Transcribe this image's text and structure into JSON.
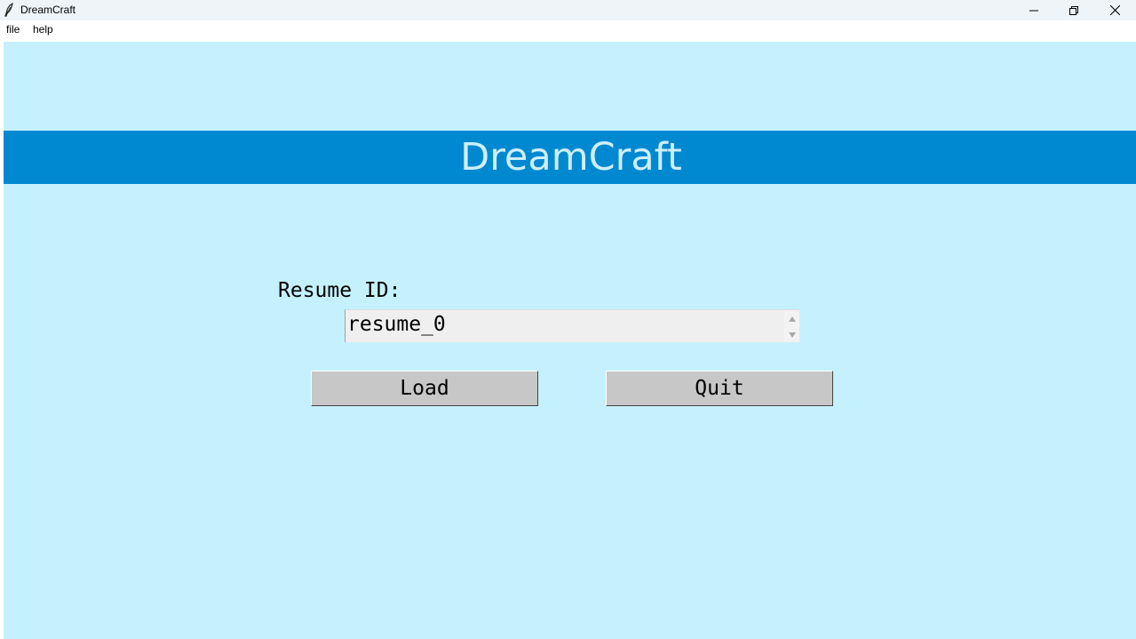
{
  "window": {
    "title": "DreamCraft"
  },
  "menu": {
    "items": [
      {
        "label": "file"
      },
      {
        "label": "help"
      }
    ]
  },
  "banner": {
    "title": "DreamCraft"
  },
  "form": {
    "resume_label": "Resume ID:",
    "resume_value": "resume_0"
  },
  "buttons": {
    "load_label": "Load",
    "quit_label": "Quit"
  },
  "colors": {
    "background": "#c4f1fd",
    "banner": "#0089d1",
    "banner_text": "#cdeefa",
    "button": "#c7c7c7",
    "spinbox": "#efefef"
  },
  "icons": {
    "app": "feather-icon",
    "minimize": "minimize-icon",
    "restore": "restore-icon",
    "close": "close-icon",
    "spin_up": "arrow-up-icon",
    "spin_down": "arrow-down-icon"
  }
}
